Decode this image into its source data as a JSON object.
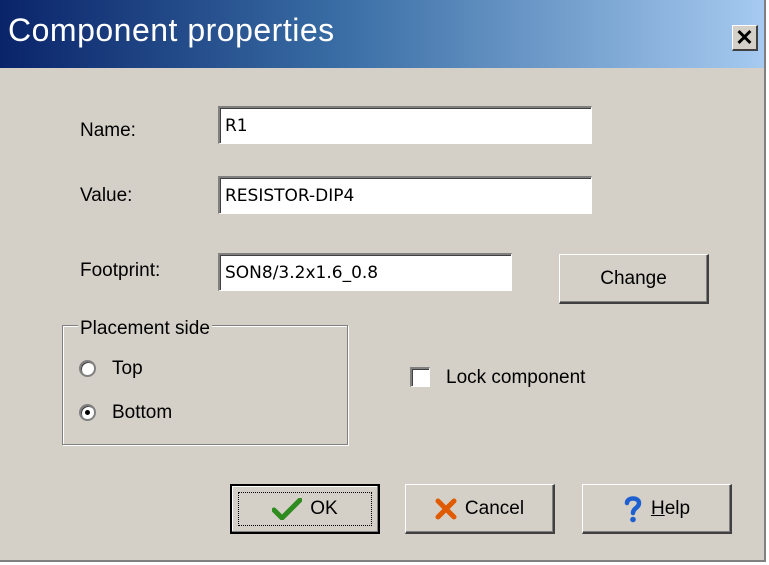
{
  "dialog": {
    "title": "Component properties",
    "close_icon": "close-icon"
  },
  "fields": {
    "name": {
      "label": "Name:",
      "value": "R1"
    },
    "value": {
      "label": "Value:",
      "value": "RESISTOR-DIP4"
    },
    "footprint": {
      "label": "Footprint:",
      "value": "SON8/3.2x1.6_0.8"
    }
  },
  "change_button": {
    "label": "Change"
  },
  "placement": {
    "group_label": "Placement side",
    "options": [
      {
        "label": "Top",
        "selected": false
      },
      {
        "label": "Bottom",
        "selected": true
      }
    ]
  },
  "lock": {
    "label": "Lock component",
    "checked": false
  },
  "buttons": {
    "ok": {
      "label": "OK",
      "icon": "checkmark-icon",
      "color": "#2e8b1e"
    },
    "cancel": {
      "label": "Cancel",
      "icon": "cross-icon",
      "color": "#e05a00"
    },
    "help": {
      "label": "Help",
      "mnemonic": "H",
      "rest": "elp",
      "icon": "question-mark-icon",
      "color": "#1e5fd0"
    }
  }
}
